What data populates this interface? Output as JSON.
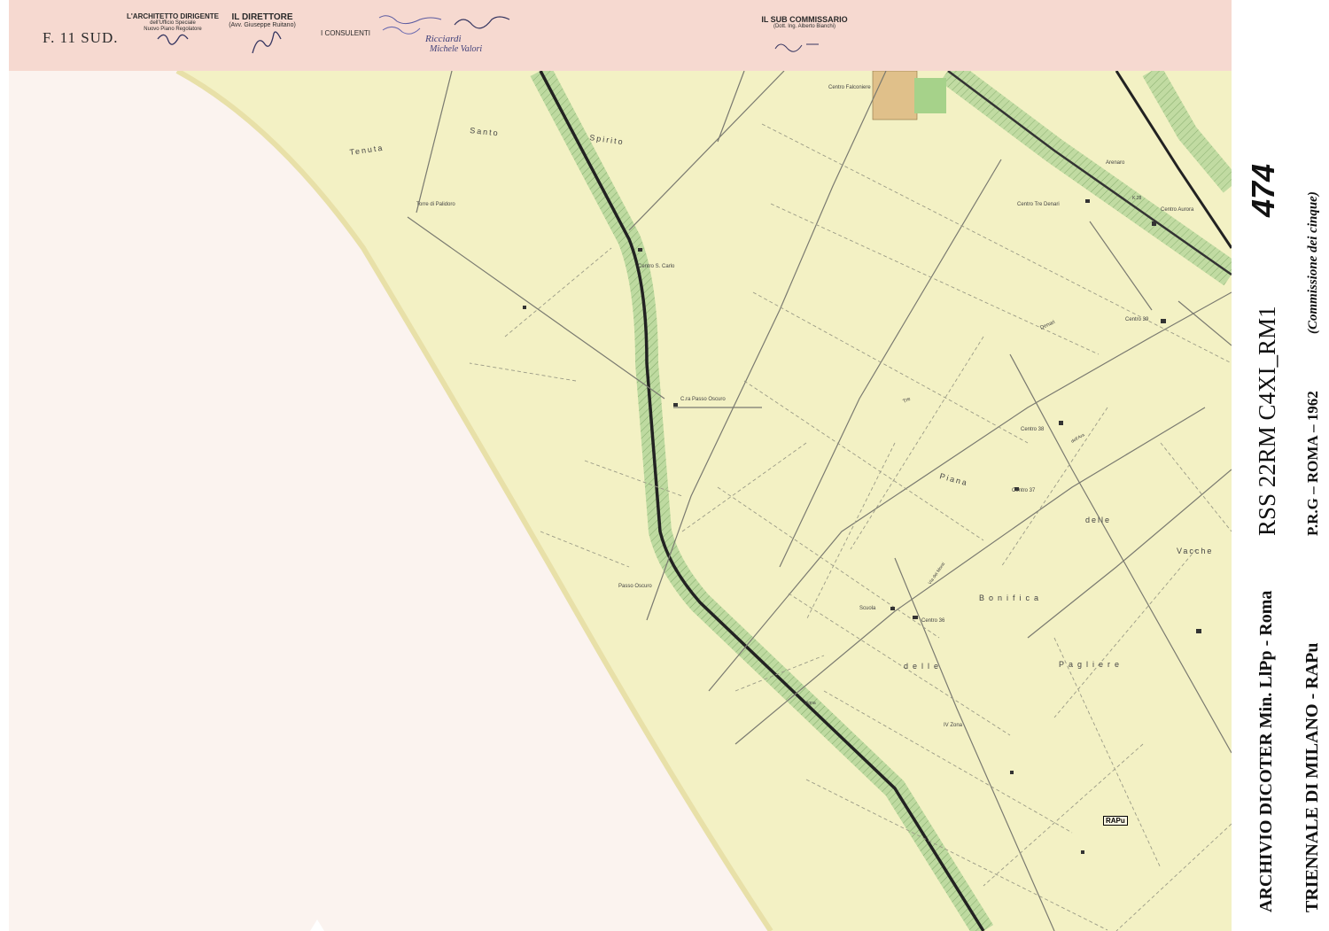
{
  "header": {
    "sheet_number": "F. 11 SUD.",
    "architect_role": "L'ARCHITETTO DIRIGENTE",
    "architect_office_1": "dell'Ufficio Speciale",
    "architect_office_2": "Nuovo Piano Regolatore",
    "director_role": "IL DIRETTORE",
    "director_name": "(Avv. Giuseppe Ruitano)",
    "consultants_role": "I CONSULENTI",
    "commissioner_role": "IL SUB COMMISSARIO",
    "commissioner_name": "(Dott. Ing. Alberto Bianchi)",
    "signatures": [
      "Ricciardi",
      "Michele Valori"
    ]
  },
  "side_text": {
    "archive": "ARCHIVIO DICOTER Min. LlPp - Roma",
    "code": "RSS 22RM C4XI_RM1",
    "number": "474",
    "institution": "TRIENNALE DI MILANO - RAPu",
    "plan": "P.R.G – ROMA – 1962",
    "commission": "(Commissione dei cinque)"
  },
  "stamp": "RAPu",
  "map_labels": {
    "tenuta": "Tenuta",
    "santo": "Santo",
    "spirito": "Spirito",
    "torre": "Torre di Palidoro",
    "centro_san_carlo": "Centro S. Carlo",
    "casa_passo_oscuro": "C.ra Passo Oscuro",
    "passo_oscuro": "Passo Oscuro",
    "centro_falconiere": "Centro Falconiere",
    "arenaro": "Arenaro",
    "km": "K.28",
    "centro_tre_denari": "Centro Tre Denari",
    "centro_aurora": "Centro Aurora",
    "denari": "Denari",
    "tre": "Tre",
    "centro_39": "Centro 39",
    "centro_38": "Centro 38",
    "centro_37": "Centro 37",
    "centro_36": "Centro 36",
    "scuola": "Scuola",
    "vigna": "Vigna",
    "iv_zona": "IV Zona",
    "via_dei_monti": "Via dei Monti",
    "dell_ara": "dell'Ara",
    "piana": "Piana",
    "delle_1": "delle",
    "vacche": "Vacche",
    "bonifica": "Bonifica",
    "delle_2": "delle",
    "pagliere": "Pagliere"
  },
  "colors": {
    "paper": "#fbf3ef",
    "header_band": "#f6d9d0",
    "land": "#f3f1c4",
    "green_band": "#a9cf8a",
    "highway": "#222222",
    "roads": "#7a7a70"
  }
}
